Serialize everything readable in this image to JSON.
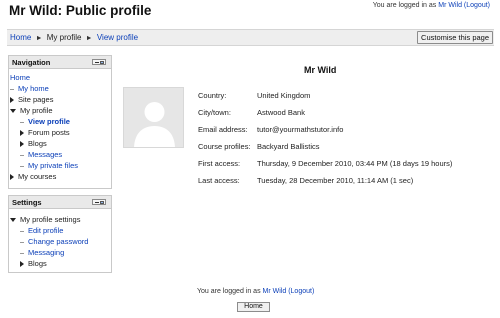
{
  "header": {
    "title": "Mr Wild: Public profile",
    "login": {
      "prefix": "You are logged in as",
      "user": "Mr Wild",
      "logout": "(Logout)"
    }
  },
  "navbar": {
    "breadcrumb": [
      "Home",
      "My profile",
      "View profile"
    ],
    "customise_label": "Customise this page"
  },
  "navigation_block": {
    "title": "Navigation",
    "items": [
      "Home",
      "My home",
      "Site pages",
      "My profile",
      "View profile",
      "Forum posts",
      "Blogs",
      "Messages",
      "My private files",
      "My courses"
    ]
  },
  "settings_block": {
    "title": "Settings",
    "items": [
      "My profile settings",
      "Edit profile",
      "Change password",
      "Messaging",
      "Blogs"
    ]
  },
  "profile": {
    "name": "Mr Wild",
    "fields": [
      {
        "label": "Country:",
        "value": "United Kingdom"
      },
      {
        "label": "City/town:",
        "value": "Astwood Bank"
      },
      {
        "label": "Email address:",
        "value": "tutor@yourmathstutor.info"
      },
      {
        "label": "Course profiles:",
        "value": "Backyard Ballistics"
      },
      {
        "label": "First access:",
        "value": "Thursday, 9 December 2010, 03:44 PM  (18 days 19 hours)"
      },
      {
        "label": "Last access:",
        "value": "Tuesday, 28 December 2010, 11:14 AM  (1 sec)"
      }
    ]
  },
  "footer": {
    "login": {
      "prefix": "You are logged in as",
      "user": "Mr Wild",
      "logout": "(Logout)"
    },
    "home_label": "Home"
  }
}
